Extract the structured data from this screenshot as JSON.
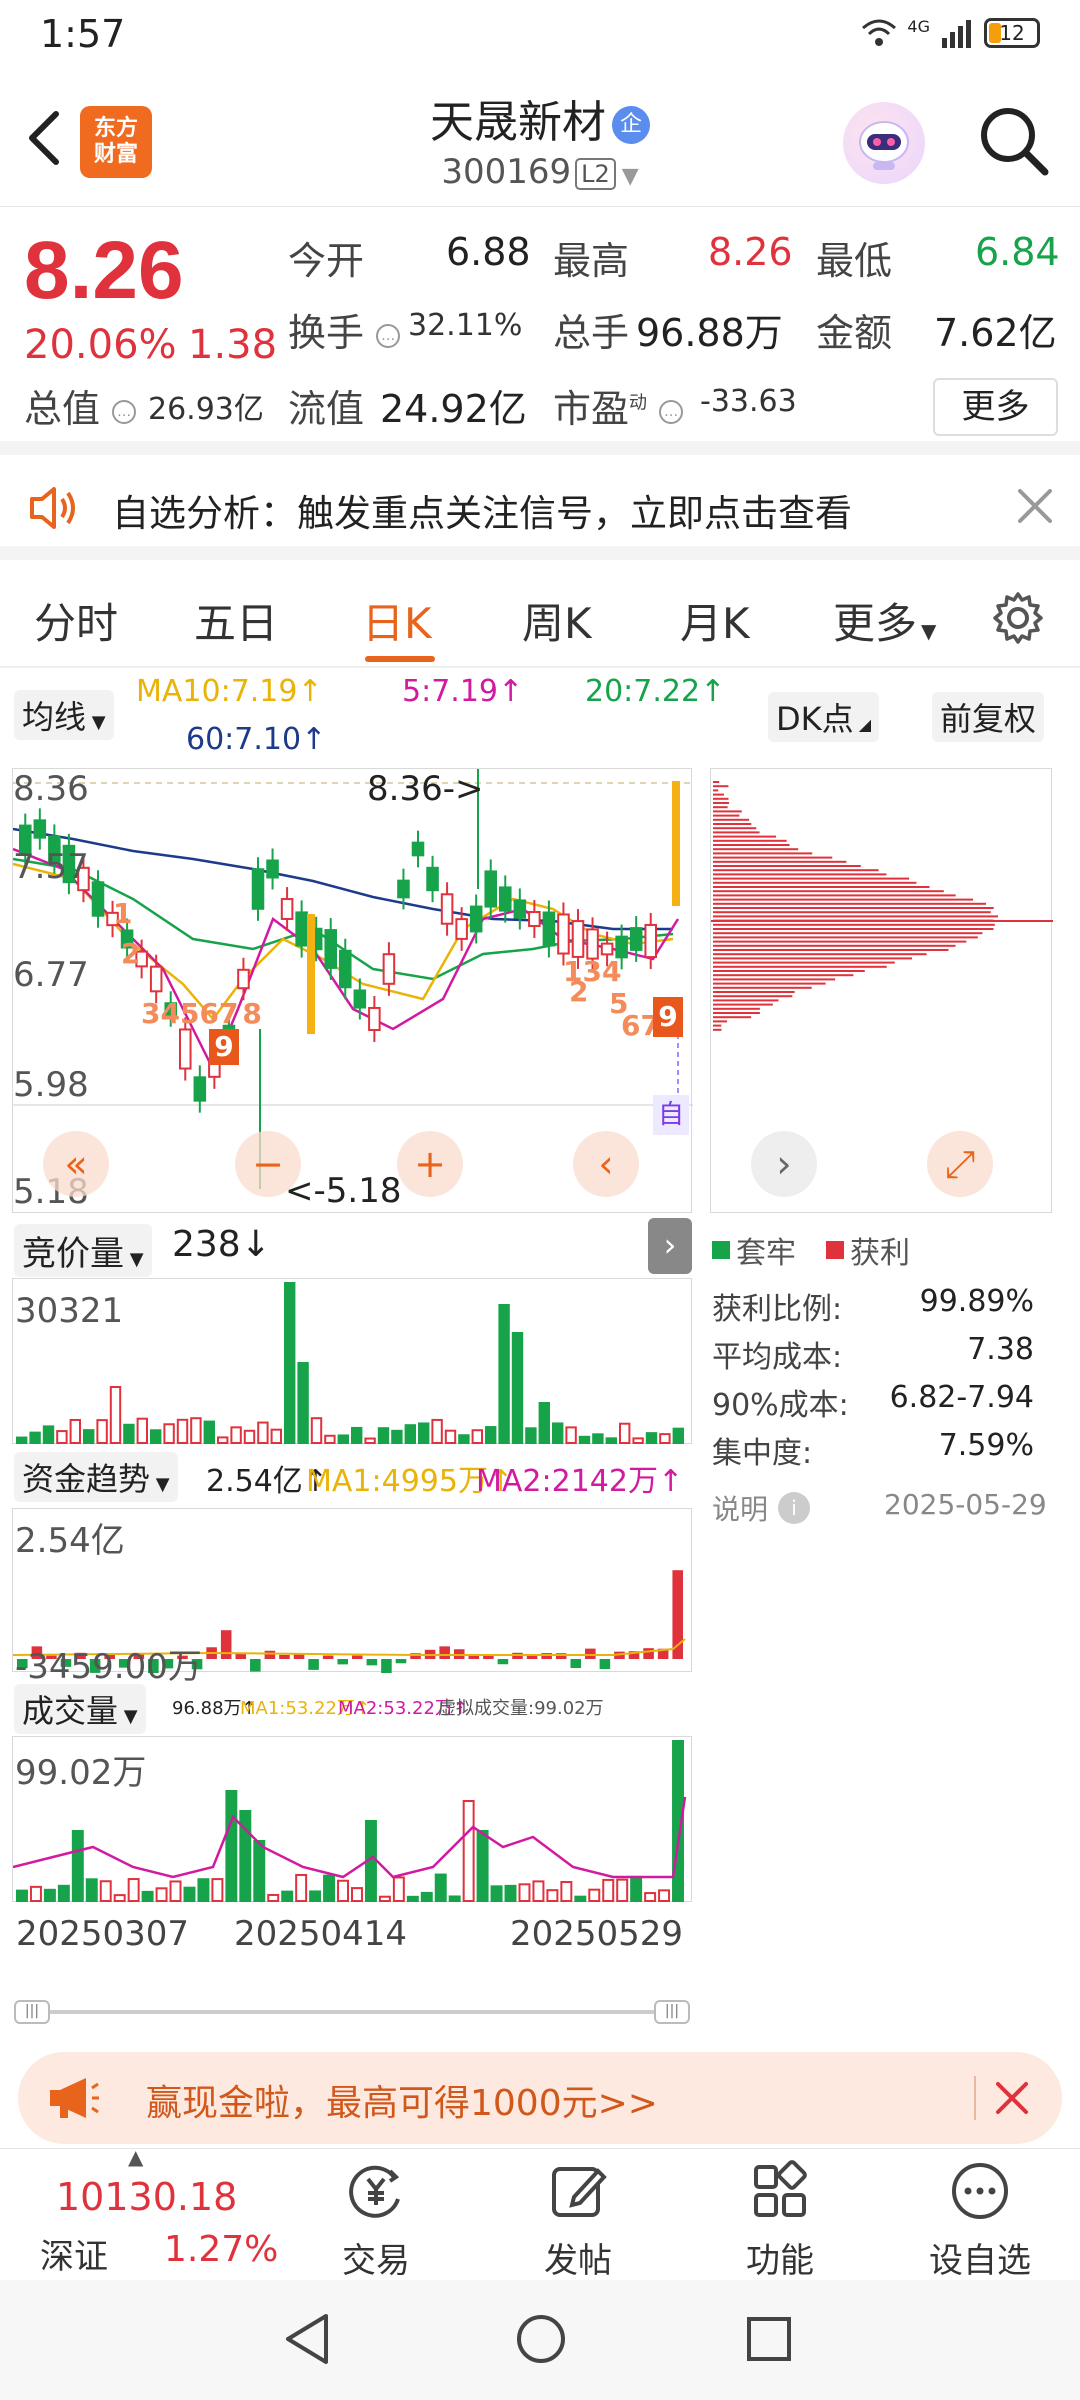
{
  "status_bar": {
    "time": "1:57",
    "network": "4G",
    "battery": "12"
  },
  "header": {
    "stock_name": "天晟新材",
    "name_badge": "企",
    "stock_code": "300169",
    "level_badge": "L2",
    "logo_line1": "东方",
    "logo_line2": "财富"
  },
  "quote": {
    "price": "8.26",
    "change_pct": "20.06%",
    "change_amt": "1.38",
    "open_label": "今开",
    "open": "6.88",
    "high_label": "最高",
    "high": "8.26",
    "low_label": "最低",
    "low": "6.84",
    "turnover_label": "换手",
    "turnover": "32.11%",
    "volume_label": "总手",
    "volume": "96.88万",
    "amount_label": "金额",
    "amount": "7.62亿",
    "total_cap_label": "总值",
    "total_cap": "26.93亿",
    "float_cap_label": "流值",
    "float_cap": "24.92亿",
    "pe_label": "市盈",
    "pe_sup": "动",
    "pe": "-33.63",
    "more_button": "更多"
  },
  "banner": {
    "text": "自选分析：触发重点关注信号，立即点击查看"
  },
  "tabs": [
    "分时",
    "五日",
    "日K",
    "周K",
    "月K",
    "更多"
  ],
  "active_tab": "日K",
  "indicator_row": {
    "ma_select": "均线",
    "ma10": "MA10:7.19↑",
    "ma5": "5:7.19↑",
    "ma20": "20:7.22↑",
    "ma60": "60:7.10↑",
    "dk_button": "DK点",
    "adjust_button": "前复权"
  },
  "kline": {
    "y_labels": [
      "8.36",
      "7.57",
      "6.77",
      "5.98",
      "5.18"
    ],
    "high_marker": "8.36->",
    "low_marker": "<-5.18",
    "signal_numbers": [
      "1",
      "2",
      "3",
      "4",
      "5",
      "6",
      "7",
      "8",
      "9",
      "1",
      "2",
      "3",
      "4",
      "5",
      "6",
      "7",
      "8",
      "9"
    ],
    "self_tag": "自"
  },
  "chip_panel": {
    "legend_trapped": "套牢",
    "legend_profit": "获利",
    "rows": [
      {
        "label": "获利比例:",
        "value": "99.89%"
      },
      {
        "label": "平均成本:",
        "value": "7.38"
      },
      {
        "label": "90%成本:",
        "value": "6.82-7.94"
      },
      {
        "label": "集中度:",
        "value": "7.59%"
      }
    ],
    "note_label": "说明",
    "date": "2025-05-29"
  },
  "auction": {
    "select": "竞价量",
    "value": "238↓",
    "y_top": "30321"
  },
  "fund_trend": {
    "select": "资金趋势",
    "value": "2.54亿↑",
    "ma1": "MA1:4995万↑",
    "ma2": "MA2:2142万↑",
    "y_top": "2.54亿",
    "y_bottom": "-3459.00万"
  },
  "volume": {
    "select": "成交量",
    "value": "96.88万↑",
    "ma1": "MA1:53.22万↑",
    "ma2": "MA2:53.22万↑",
    "virtual": "虚拟成交量:99.02万",
    "y_top": "99.02万",
    "dates": [
      "20250307",
      "20250414",
      "20250529"
    ]
  },
  "promo": {
    "text": "赢现金啦，最高可得1000元>>"
  },
  "bottom_nav": {
    "index_value": "10130.18",
    "index_name": "深证",
    "index_pct": "1.27%",
    "items": [
      "交易",
      "发帖",
      "功能",
      "设自选"
    ]
  },
  "colors": {
    "up": "#e0323c",
    "down": "#17a34a",
    "accent": "#e8641c"
  }
}
